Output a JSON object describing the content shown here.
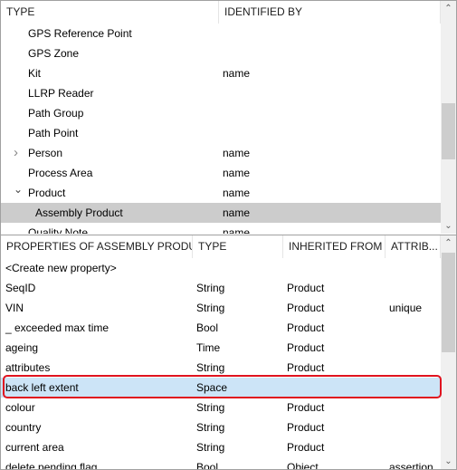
{
  "types_panel": {
    "headers": [
      "TYPE",
      "IDENTIFIED BY"
    ],
    "rows": [
      {
        "type": "GPS Reference Point",
        "identified_by": ""
      },
      {
        "type": "GPS Zone",
        "identified_by": ""
      },
      {
        "type": "Kit",
        "identified_by": "name"
      },
      {
        "type": "LLRP Reader",
        "identified_by": ""
      },
      {
        "type": "Path Group",
        "identified_by": ""
      },
      {
        "type": "Path Point",
        "identified_by": ""
      },
      {
        "type": "Person",
        "identified_by": "name",
        "expander": "collapsed"
      },
      {
        "type": "Process Area",
        "identified_by": "name"
      },
      {
        "type": "Product",
        "identified_by": "name",
        "expander": "expanded"
      },
      {
        "type": "Assembly Product",
        "identified_by": "name",
        "selected": true
      },
      {
        "type": "Quality Note",
        "identified_by": "name"
      }
    ]
  },
  "properties_panel": {
    "headers": [
      "PROPERTIES OF ASSEMBLY PRODUCT",
      "TYPE",
      "INHERITED FROM",
      "ATTRIB..."
    ],
    "rows": [
      {
        "name": "<Create new property>",
        "type": "",
        "inherited": "",
        "attrib": ""
      },
      {
        "name": "SeqID",
        "type": "String",
        "inherited": "Product",
        "attrib": ""
      },
      {
        "name": "VIN",
        "type": "String",
        "inherited": "Product",
        "attrib": "unique"
      },
      {
        "name": "_ exceeded max time",
        "type": "Bool",
        "inherited": "Product",
        "attrib": ""
      },
      {
        "name": "ageing",
        "type": "Time",
        "inherited": "Product",
        "attrib": ""
      },
      {
        "name": "attributes",
        "type": "String",
        "inherited": "Product",
        "attrib": ""
      },
      {
        "name": "back left extent",
        "type": "Space",
        "inherited": "",
        "attrib": "",
        "selected": true
      },
      {
        "name": "colour",
        "type": "String",
        "inherited": "Product",
        "attrib": ""
      },
      {
        "name": "country",
        "type": "String",
        "inherited": "Product",
        "attrib": ""
      },
      {
        "name": "current area",
        "type": "String",
        "inherited": "Product",
        "attrib": ""
      },
      {
        "name": "delete pending flag",
        "type": "Bool",
        "inherited": "Object",
        "attrib": "assertion"
      }
    ]
  },
  "colors": {
    "highlight_border": "#e0131f",
    "selected_blue": "#cce4f7",
    "selected_gray": "#cccccc"
  }
}
